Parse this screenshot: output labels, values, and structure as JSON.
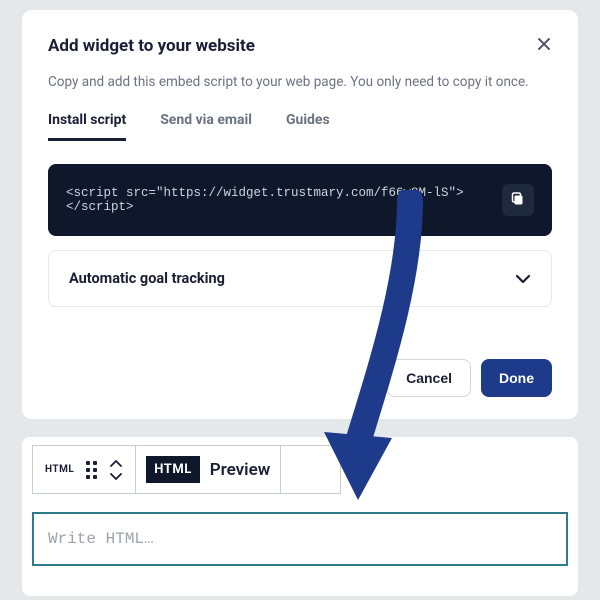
{
  "modal": {
    "title": "Add widget to your website",
    "description": "Copy and add this embed script to your web page. You only need to copy it once.",
    "tabs": {
      "install": "Install script",
      "email": "Send via email",
      "guides": "Guides"
    },
    "script_code": "<script src=\"https://widget.trustmary.com/f66w8M-lS\"></script>",
    "accordion": {
      "title": "Automatic goal tracking"
    },
    "buttons": {
      "cancel": "Cancel",
      "done": "Done"
    }
  },
  "editor": {
    "html_badge_small": "HTML",
    "html_badge_large": "HTML",
    "preview_label": "Preview",
    "input_placeholder": "Write HTML…"
  }
}
